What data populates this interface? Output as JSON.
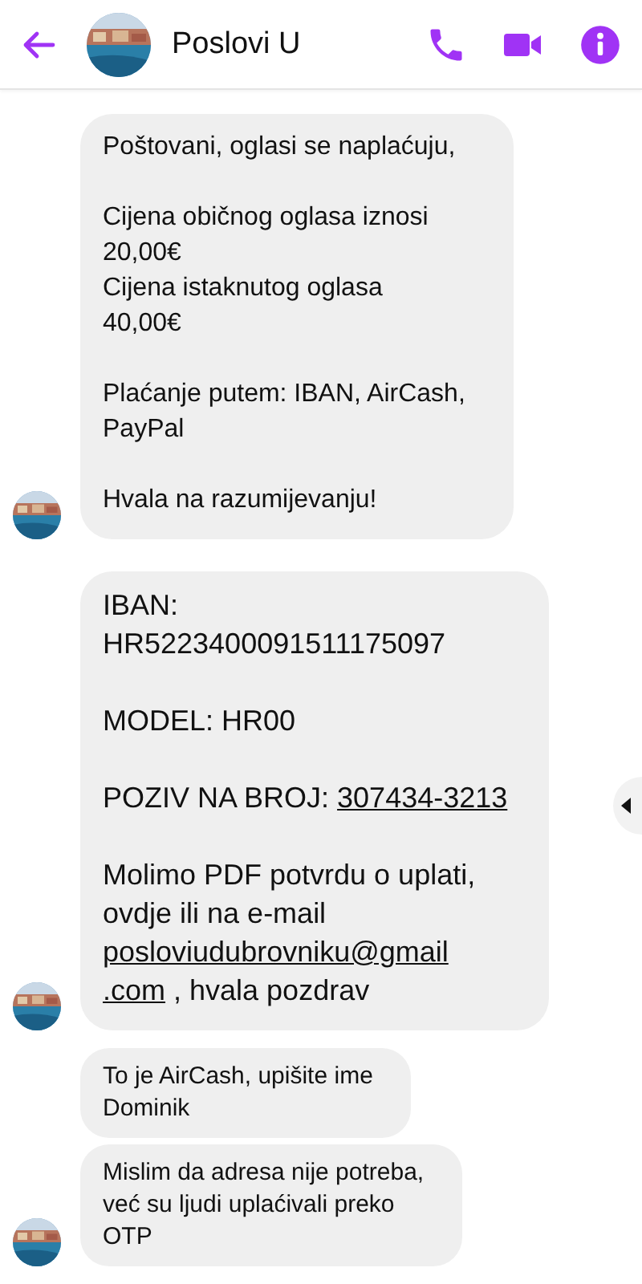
{
  "header": {
    "title": "Poslovi U"
  },
  "messages": [
    {
      "kind": "text",
      "avatar": true,
      "paragraphs": [
        {
          "lines": [
            [
              {
                "text": "Poštovani, oglasi se naplaćuju,",
                "link": false
              }
            ]
          ]
        },
        {
          "lines": [
            [
              {
                "text": "Cijena običnog oglasa iznosi",
                "link": false
              }
            ],
            [
              {
                "text": "20,00€",
                "link": false
              }
            ],
            [
              {
                "text": "Cijena istaknutog oglasa",
                "link": false
              }
            ],
            [
              {
                "text": "40,00€",
                "link": false
              }
            ]
          ]
        },
        {
          "lines": [
            [
              {
                "text": "Plaćanje putem: IBAN, AirCash,",
                "link": false
              }
            ],
            [
              {
                "text": "PayPal",
                "link": false
              }
            ]
          ]
        },
        {
          "lines": [
            [
              {
                "text": "Hvala na razumijevanju!",
                "link": false
              }
            ]
          ]
        }
      ]
    },
    {
      "kind": "large_text",
      "avatar": true,
      "paragraphs": [
        {
          "lines": [
            [
              {
                "text": "IBAN:",
                "link": false
              }
            ],
            [
              {
                "text": "HR5223400091511175097",
                "link": false
              }
            ]
          ]
        },
        {
          "lines": [
            [
              {
                "text": "MODEL: HR00",
                "link": false
              }
            ]
          ]
        },
        {
          "lines": [
            [
              {
                "text": "POZIV NA BROJ: ",
                "link": false
              },
              {
                "text": "307434-3213",
                "link": true
              }
            ]
          ]
        },
        {
          "lines": [
            [
              {
                "text": "Molimo PDF potvrdu o uplati,",
                "link": false
              }
            ],
            [
              {
                "text": "ovdje ili na e-mail",
                "link": false
              }
            ],
            [
              {
                "text": "posloviudubrovniku@gmail",
                "link": true
              }
            ],
            [
              {
                "text": ".com",
                "link": true
              },
              {
                "text": " , hvala pozdrav",
                "link": false
              }
            ]
          ]
        }
      ]
    },
    {
      "kind": "small_text",
      "avatar": false,
      "paragraphs": [
        {
          "lines": [
            [
              {
                "text": "To je AirCash, upišite ime",
                "link": false
              }
            ],
            [
              {
                "text": "Dominik",
                "link": false
              }
            ]
          ]
        }
      ]
    },
    {
      "kind": "small_text",
      "avatar": true,
      "paragraphs": [
        {
          "lines": [
            [
              {
                "text": "Mislim da adresa nije potreba,",
                "link": false
              }
            ],
            [
              {
                "text": "već su ljudi uplaćivali preko",
                "link": false
              }
            ],
            [
              {
                "text": "OTP",
                "link": false
              }
            ]
          ]
        }
      ]
    }
  ]
}
